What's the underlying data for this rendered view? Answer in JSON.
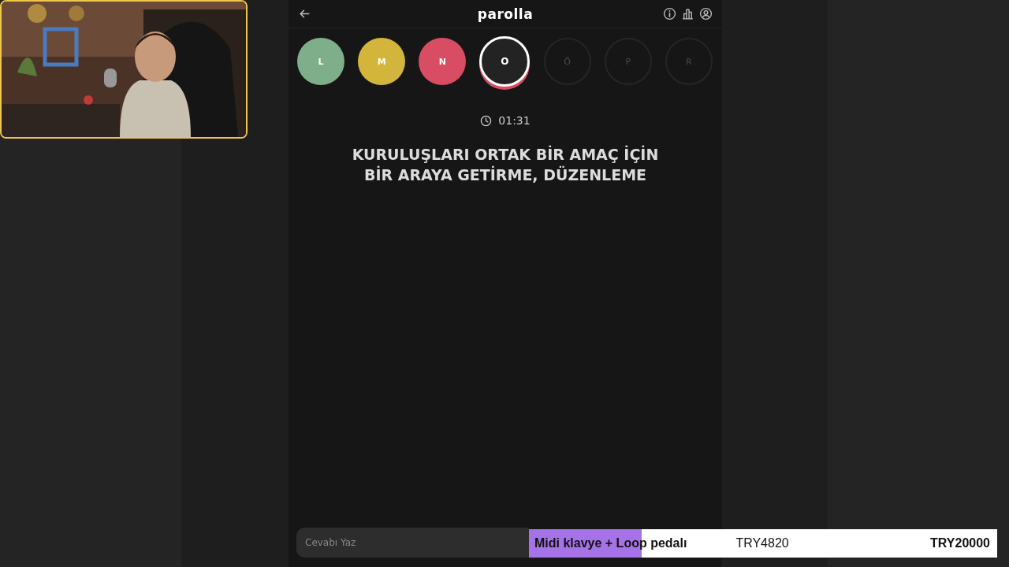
{
  "header": {
    "title": "parolla"
  },
  "letters": [
    {
      "label": "L",
      "kind": "answered",
      "color": "#7fae8a"
    },
    {
      "label": "M",
      "kind": "answered",
      "color": "#d4b53c"
    },
    {
      "label": "N",
      "kind": "answered",
      "color": "#d84d63"
    },
    {
      "label": "O",
      "kind": "current"
    },
    {
      "label": "Ö",
      "kind": "pending"
    },
    {
      "label": "P",
      "kind": "pending"
    },
    {
      "label": "R",
      "kind": "pending"
    }
  ],
  "timer": "01:31",
  "question": "KURULUŞLARI ORTAK BİR AMAÇ İÇİN BİR ARAYA GETİRME, DÜZENLEME",
  "answer": {
    "placeholder": "Cevabı Yaz"
  },
  "goal": {
    "label": "Midi klavye + Loop pedalı",
    "raised": "TRY4820",
    "target": "TRY20000",
    "level": 0.241
  }
}
